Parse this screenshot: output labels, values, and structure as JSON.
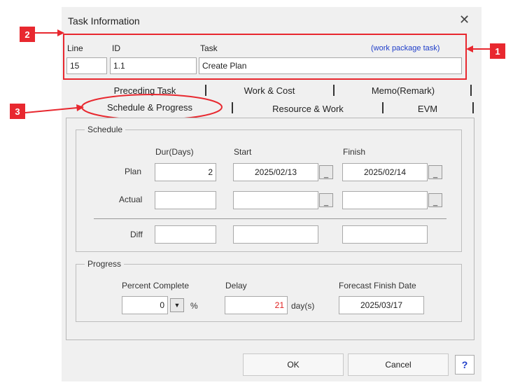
{
  "window": {
    "title": "Task Information",
    "close_icon": "close-icon"
  },
  "callouts": {
    "one": "1",
    "two": "2",
    "three": "3"
  },
  "header": {
    "line_label": "Line",
    "id_label": "ID",
    "task_label": "Task",
    "line_value": "15",
    "id_value": "1.1",
    "task_value": "Create Plan",
    "badge": "(work package task)"
  },
  "tabs": {
    "preceding": "Preceding Task",
    "work_cost": "Work & Cost",
    "memo": "Memo(Remark)",
    "schedule": "Schedule & Progress",
    "resource": "Resource & Work",
    "evm": "EVM"
  },
  "schedule": {
    "legend": "Schedule",
    "col_dur": "Dur(Days)",
    "col_start": "Start",
    "col_finish": "Finish",
    "row_plan": "Plan",
    "row_actual": "Actual",
    "row_diff": "Diff",
    "plan_dur": "2",
    "plan_start": "2025/02/13",
    "plan_finish": "2025/02/14",
    "actual_dur": "",
    "actual_start": "",
    "actual_finish": "",
    "diff_dur": "",
    "diff_start": "",
    "diff_finish": ""
  },
  "progress": {
    "legend": "Progress",
    "percent_label": "Percent Complete",
    "percent_value": "0",
    "percent_unit": "%",
    "delay_label": "Delay",
    "delay_value": "21",
    "delay_unit": "day(s)",
    "forecast_label": "Forecast Finish Date",
    "forecast_value": "2025/03/17"
  },
  "buttons": {
    "ok": "OK",
    "cancel": "Cancel",
    "help": "?"
  },
  "colors": {
    "callout": "#e8282f",
    "badge": "#1f3ec9",
    "delay": "#e02020"
  }
}
